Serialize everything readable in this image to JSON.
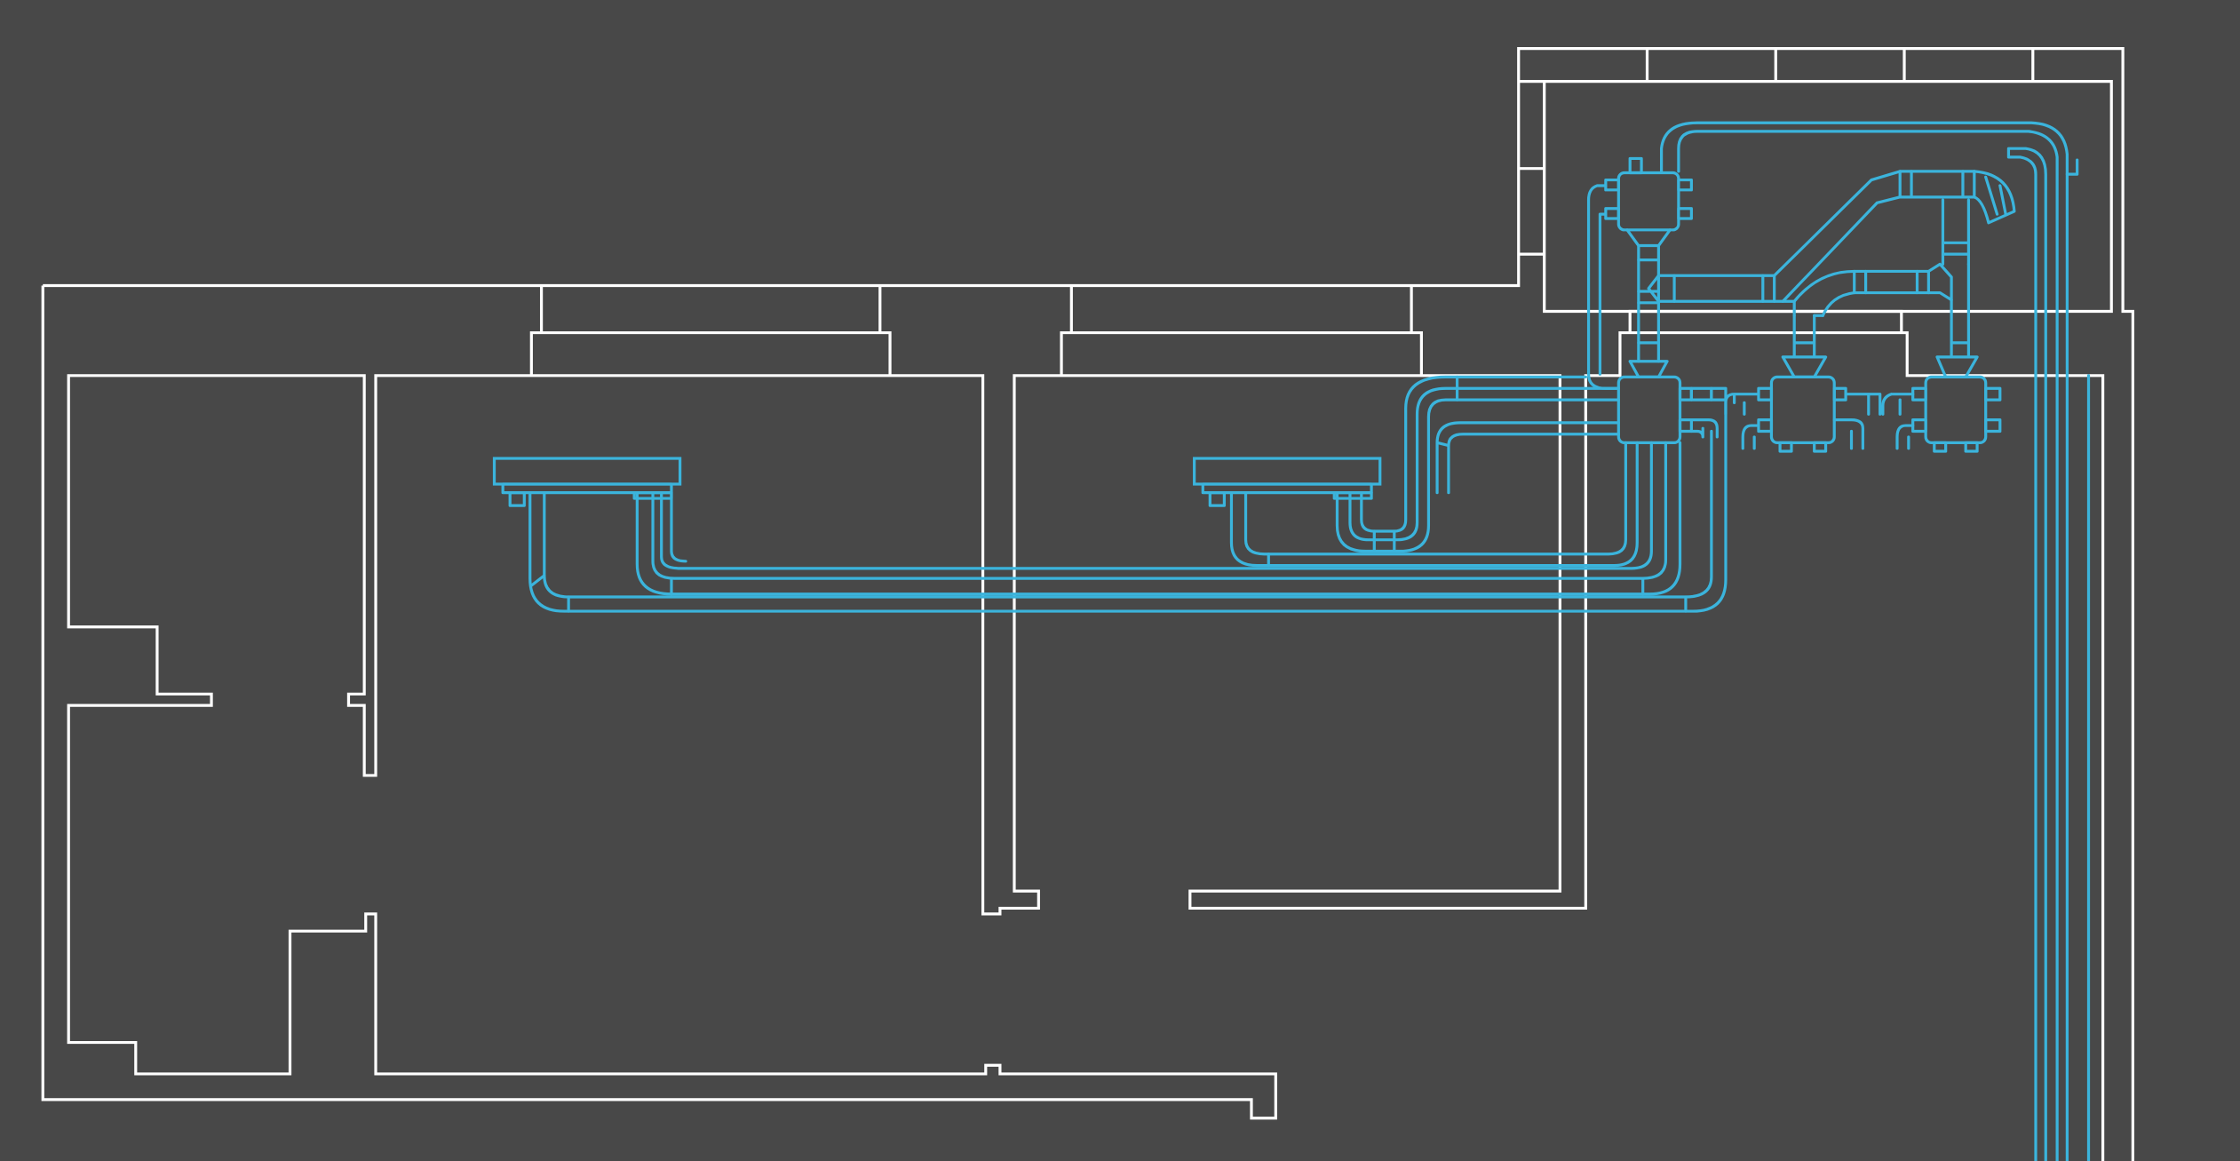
{
  "drawing": {
    "background_color": "#484848",
    "wall_color": "#ffffff",
    "duct_color": "#3bb4dc",
    "units": {
      "indoor_unit_left": "cassette-ac-unit",
      "indoor_unit_right": "cassette-ac-unit",
      "distribution_boxes": [
        "distribution-box-top",
        "distribution-box-main",
        "distribution-box-mid",
        "distribution-box-right"
      ]
    }
  }
}
